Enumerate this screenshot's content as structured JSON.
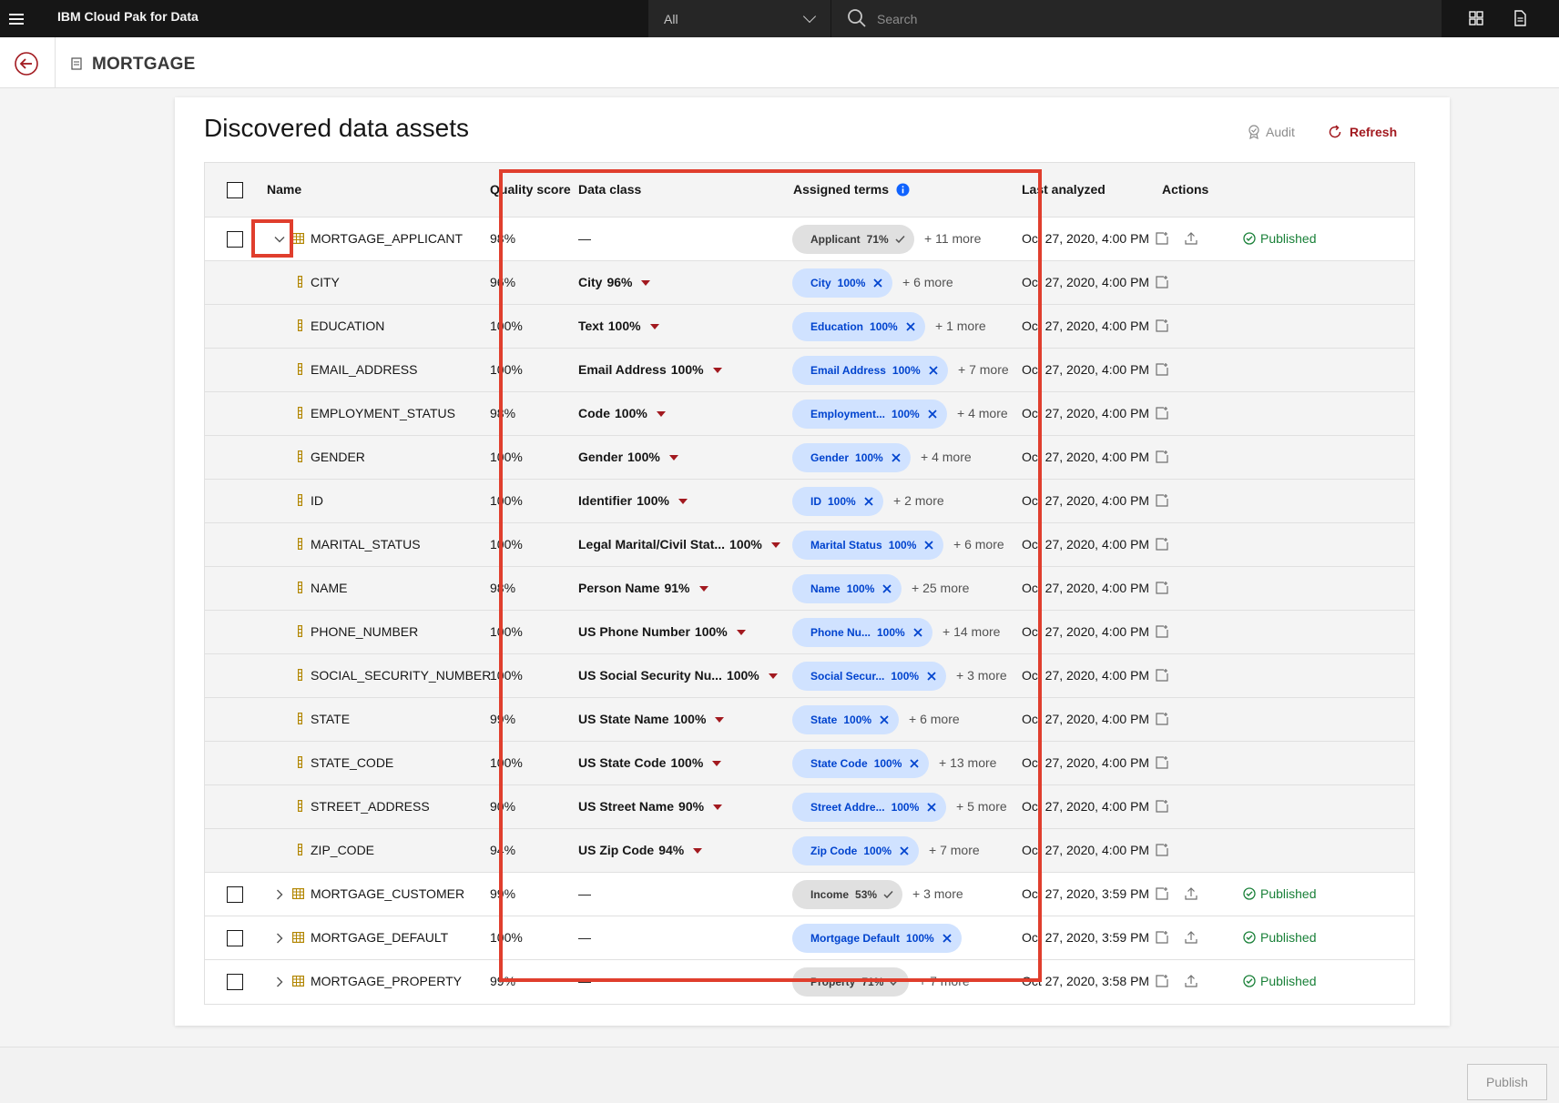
{
  "topbar": {
    "product": "IBM Cloud Pak for Data",
    "scope_value": "All",
    "search_placeholder": "Search"
  },
  "header": {
    "title": "MORTGAGE"
  },
  "card": {
    "title": "Discovered data assets",
    "audit_label": "Audit",
    "refresh_label": "Refresh"
  },
  "table": {
    "headers": {
      "name": "Name",
      "quality": "Quality score",
      "data_class": "Data class",
      "terms": "Assigned terms",
      "last_analyzed": "Last analyzed",
      "actions": "Actions"
    },
    "rows": [
      {
        "name": "MORTGAGE_APPLICANT",
        "quality": "98%",
        "class_name": "—",
        "class_pct": "",
        "term": "Applicant",
        "term_pct": "71%",
        "more": "+ 11 more",
        "analyzed": "Oct 27, 2020, 4:00 PM",
        "status": "Published"
      },
      {
        "name": "CITY",
        "quality": "96%",
        "class_name": "City",
        "class_pct": "96%",
        "term": "City",
        "term_pct": "100%",
        "more": "+ 6 more",
        "analyzed": "Oct 27, 2020, 4:00 PM"
      },
      {
        "name": "EDUCATION",
        "quality": "100%",
        "class_name": "Text",
        "class_pct": "100%",
        "term": "Education",
        "term_pct": "100%",
        "more": "+ 1 more",
        "analyzed": "Oct 27, 2020, 4:00 PM"
      },
      {
        "name": "EMAIL_ADDRESS",
        "quality": "100%",
        "class_name": "Email Address",
        "class_pct": "100%",
        "term": "Email Address",
        "term_pct": "100%",
        "more": "+ 7 more",
        "analyzed": "Oct 27, 2020, 4:00 PM"
      },
      {
        "name": "EMPLOYMENT_STATUS",
        "quality": "98%",
        "class_name": "Code",
        "class_pct": "100%",
        "term": "Employment...",
        "term_pct": "100%",
        "more": "+ 4 more",
        "analyzed": "Oct 27, 2020, 4:00 PM"
      },
      {
        "name": "GENDER",
        "quality": "100%",
        "class_name": "Gender",
        "class_pct": "100%",
        "term": "Gender",
        "term_pct": "100%",
        "more": "+ 4 more",
        "analyzed": "Oct 27, 2020, 4:00 PM"
      },
      {
        "name": "ID",
        "quality": "100%",
        "class_name": "Identifier",
        "class_pct": "100%",
        "term": "ID",
        "term_pct": "100%",
        "more": "+ 2 more",
        "analyzed": "Oct 27, 2020, 4:00 PM"
      },
      {
        "name": "MARITAL_STATUS",
        "quality": "100%",
        "class_name": "Legal Marital/Civil Stat...",
        "class_pct": "100%",
        "term": "Marital Status",
        "term_pct": "100%",
        "more": "+ 6 more",
        "analyzed": "Oct 27, 2020, 4:00 PM"
      },
      {
        "name": "NAME",
        "quality": "98%",
        "class_name": "Person Name",
        "class_pct": "91%",
        "term": "Name",
        "term_pct": "100%",
        "more": "+ 25 more",
        "analyzed": "Oct 27, 2020, 4:00 PM"
      },
      {
        "name": "PHONE_NUMBER",
        "quality": "100%",
        "class_name": "US Phone Number",
        "class_pct": "100%",
        "term": "Phone Nu...",
        "term_pct": "100%",
        "more": "+ 14 more",
        "analyzed": "Oct 27, 2020, 4:00 PM"
      },
      {
        "name": "SOCIAL_SECURITY_NUMBER",
        "quality": "100%",
        "class_name": "US Social Security Nu...",
        "class_pct": "100%",
        "term": "Social Secur...",
        "term_pct": "100%",
        "more": "+ 3 more",
        "analyzed": "Oct 27, 2020, 4:00 PM"
      },
      {
        "name": "STATE",
        "quality": "99%",
        "class_name": "US State Name",
        "class_pct": "100%",
        "term": "State",
        "term_pct": "100%",
        "more": "+ 6 more",
        "analyzed": "Oct 27, 2020, 4:00 PM"
      },
      {
        "name": "STATE_CODE",
        "quality": "100%",
        "class_name": "US State Code",
        "class_pct": "100%",
        "term": "State Code",
        "term_pct": "100%",
        "more": "+ 13 more",
        "analyzed": "Oct 27, 2020, 4:00 PM"
      },
      {
        "name": "STREET_ADDRESS",
        "quality": "90%",
        "class_name": "US Street Name",
        "class_pct": "90%",
        "term": "Street Addre...",
        "term_pct": "100%",
        "more": "+ 5 more",
        "analyzed": "Oct 27, 2020, 4:00 PM"
      },
      {
        "name": "ZIP_CODE",
        "quality": "94%",
        "class_name": "US Zip Code",
        "class_pct": "94%",
        "term": "Zip Code",
        "term_pct": "100%",
        "more": "+ 7 more",
        "analyzed": "Oct 27, 2020, 4:00 PM"
      },
      {
        "name": "MORTGAGE_CUSTOMER",
        "quality": "99%",
        "class_name": "—",
        "class_pct": "",
        "term": "Income",
        "term_pct": "53%",
        "more": "+ 3 more",
        "analyzed": "Oct 27, 2020, 3:59 PM",
        "status": "Published"
      },
      {
        "name": "MORTGAGE_DEFAULT",
        "quality": "100%",
        "class_name": "—",
        "class_pct": "",
        "term": "Mortgage Default",
        "term_pct": "100%",
        "more": "",
        "analyzed": "Oct 27, 2020, 3:59 PM",
        "status": "Published"
      },
      {
        "name": "MORTGAGE_PROPERTY",
        "quality": "99%",
        "class_name": "—",
        "class_pct": "",
        "term": "Property",
        "term_pct": "71%",
        "more": "+ 7 more",
        "analyzed": "Oct 27, 2020, 3:58 PM",
        "status": "Published"
      }
    ]
  },
  "footer": {
    "publish_label": "Publish"
  }
}
